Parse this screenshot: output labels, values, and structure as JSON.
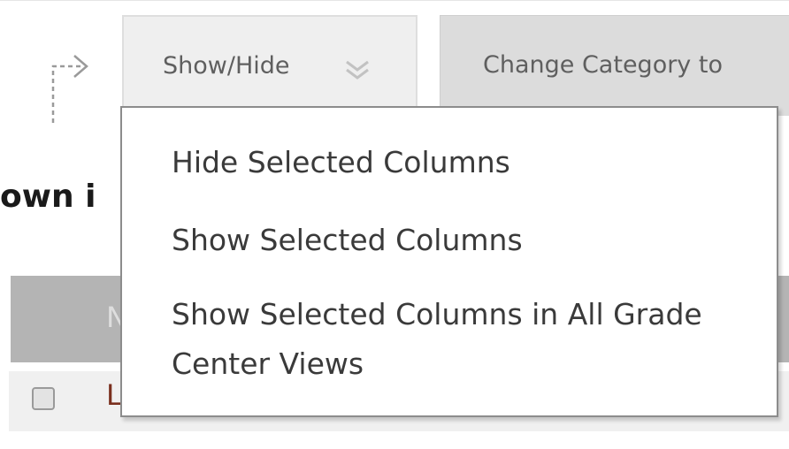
{
  "toolbar": {
    "show_hide_label": "Show/Hide",
    "change_category_label": "Change Category to"
  },
  "page": {
    "heading_fragment": "own i"
  },
  "table": {
    "header_fragment": "N",
    "row_link_fragment": "L"
  },
  "dropdown": {
    "items": [
      {
        "label": "Hide Selected Columns"
      },
      {
        "label": "Show Selected Columns"
      },
      {
        "label": "Show Selected Columns in All Grade Center Views"
      }
    ]
  }
}
